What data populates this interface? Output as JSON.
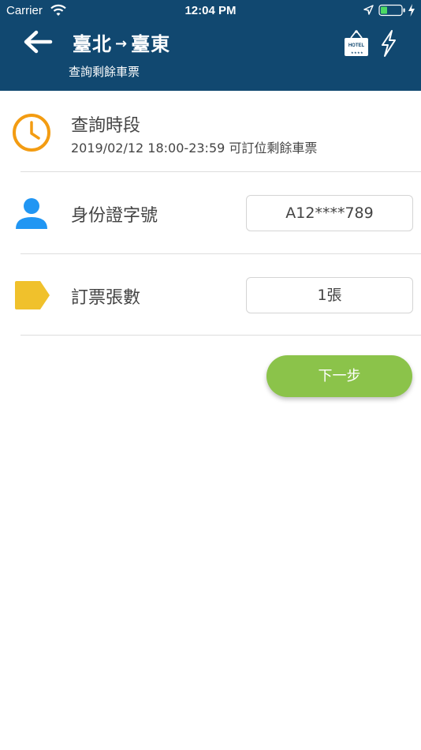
{
  "status_bar": {
    "carrier": "Carrier",
    "time": "12:04 PM"
  },
  "header": {
    "origin": "臺北",
    "arrow": "→",
    "destination": "臺東",
    "subtitle": "查詢剩餘車票",
    "hotel_label": "HOTEL",
    "background_color": "#114870"
  },
  "query_period": {
    "title": "查詢時段",
    "detail": "2019/02/12 18:00-23:59 可訂位剩餘車票",
    "icon": "clock-icon",
    "icon_color": "#f39c12"
  },
  "id_number": {
    "label": "身份證字號",
    "value": "A12****789",
    "icon": "person-icon",
    "icon_color": "#2196f3"
  },
  "ticket_count": {
    "label": "訂票張數",
    "value": "1張",
    "icon": "tag-icon",
    "icon_color": "#f0c12c"
  },
  "next_button": {
    "label": "下一步",
    "color": "#8bc34a"
  }
}
